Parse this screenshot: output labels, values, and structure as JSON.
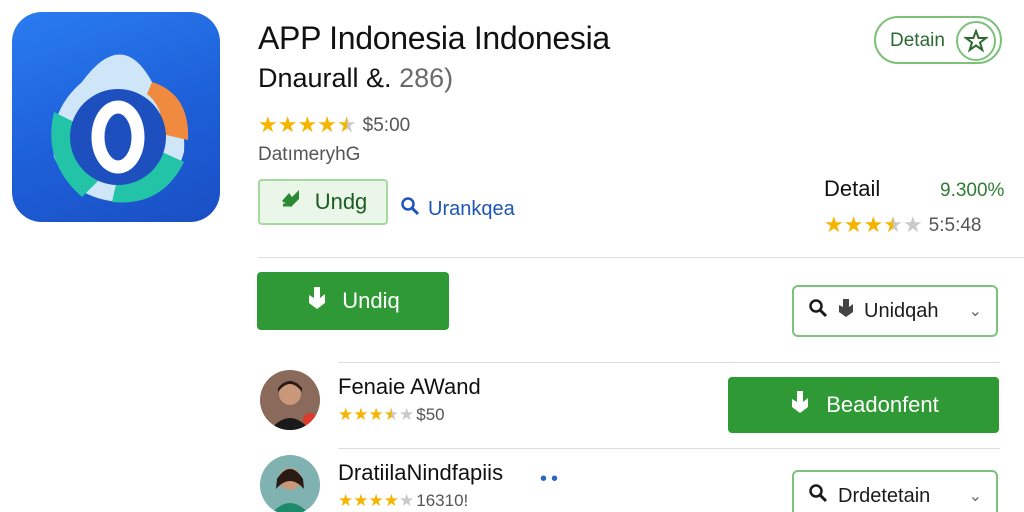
{
  "app": {
    "title": "APP Indonesia Indonesia",
    "subtitle_main": "Dnaurall &.",
    "subtitle_count": "286)",
    "rating_value": 4.5,
    "rating_text": "$5:00",
    "developer": "DatımeryhG",
    "icon_name": "app-logo-icon"
  },
  "buttons": {
    "install_light": "Undg",
    "search_link": "Urankqea",
    "detail_pill": "Detain",
    "install_primary": "Undiq",
    "dropdown_1": "Unidqah",
    "download_2": "Beadonfent",
    "dropdown_2": "Drdetetain"
  },
  "detail": {
    "label": "Detail",
    "value": "9.300%",
    "rating_value": 3.5,
    "rating_text": "5:5:48"
  },
  "users": [
    {
      "name": "Fenaie AWand",
      "rating_value": 3.5,
      "rating_text": "$50"
    },
    {
      "name": "DratiilaNindfapiis",
      "rating_value": 4,
      "rating_text": "16310!"
    }
  ],
  "colors": {
    "accent_green": "#2f9a35",
    "outline_green": "#7cc27a",
    "star_gold": "#f4b400",
    "link_blue": "#1e55b8",
    "icon_blue": "#1d5fd8"
  }
}
